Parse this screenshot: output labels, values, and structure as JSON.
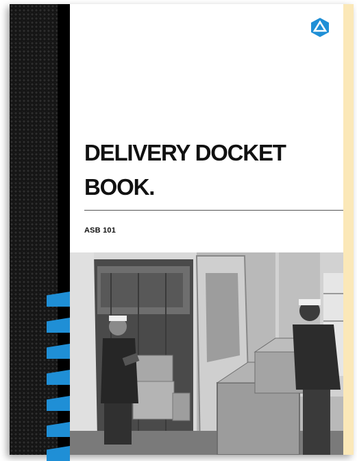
{
  "brand": {
    "logo_icon": "triangle-hex-logo-icon",
    "logo_color": "#1f8fd6"
  },
  "cover": {
    "title_line1": "DELIVERY DOCKET",
    "title_line2": "BOOK.",
    "product_code": "ASB 101",
    "photo_icon": "delivery-van-photo"
  },
  "colors": {
    "accent_stripes": "#1f8fd6",
    "spine": "#151515",
    "page_edge": "#fbe8b8"
  }
}
